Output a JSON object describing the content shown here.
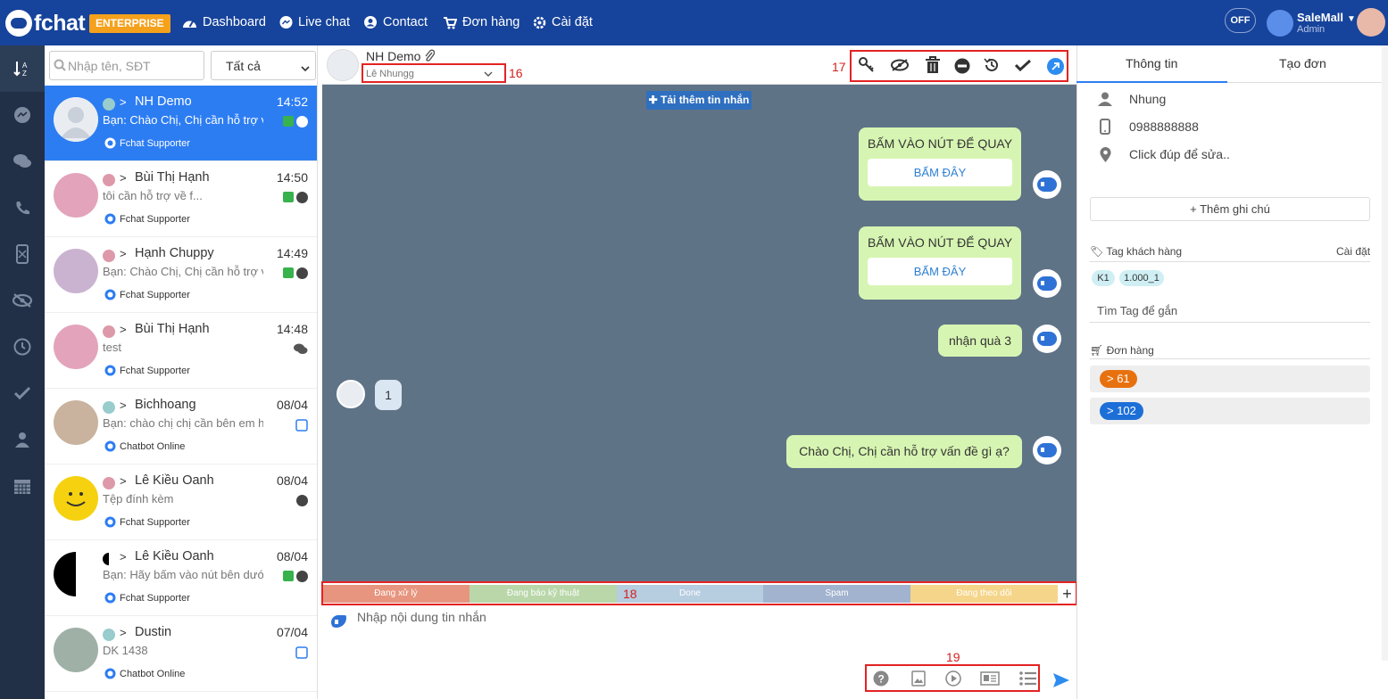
{
  "topbar": {
    "brand": "fchat",
    "plan": "ENTERPRISE",
    "nav": [
      {
        "label": "Dashboard",
        "icon": "dashboard-icon"
      },
      {
        "label": "Live chat",
        "icon": "messenger-icon"
      },
      {
        "label": "Contact",
        "icon": "contact-icon"
      },
      {
        "label": "Đơn hàng",
        "icon": "cart-icon"
      },
      {
        "label": "Cài đặt",
        "icon": "settings-icon"
      }
    ],
    "toggle": "OFF",
    "shop_name": "SaleMall",
    "role": "Admin"
  },
  "search": {
    "placeholder": "Nhập tên, SĐT"
  },
  "filter": {
    "selected": "Tất cả"
  },
  "conversations": [
    {
      "name": "NH Demo",
      "time": "14:52",
      "preview": "Bạn: Chào Chị, Chị cần hỗ trợ v...",
      "agent": "Fchat Supporter"
    },
    {
      "name": "Bùi Thị Hạnh",
      "time": "14:50",
      "preview": "tôi cần hỗ trợ về f...",
      "agent": "Fchat Supporter"
    },
    {
      "name": "Hạnh Chuppy",
      "time": "14:49",
      "preview": "Bạn: Chào Chị, Chị cần hỗ trợ v...",
      "agent": "Fchat Supporter"
    },
    {
      "name": "Bùi Thị Hạnh",
      "time": "14:48",
      "preview": "test",
      "agent": "Fchat Supporter"
    },
    {
      "name": "Bichhoang",
      "time": "08/04",
      "preview": "Bạn: chào chị chị cần bên em h...",
      "agent": "Chatbot Online"
    },
    {
      "name": "Lê Kiều Oanh",
      "time": "08/04",
      "preview": "Tệp đính kèm",
      "agent": "Fchat Supporter"
    },
    {
      "name": "Lê Kiều Oanh",
      "time": "08/04",
      "preview": "Bạn: Hãy bấm vào nút bên dưới...",
      "agent": "Fchat Supporter"
    },
    {
      "name": "Dustin",
      "time": "07/04",
      "preview": "DK 1438",
      "agent": "Chatbot Online"
    }
  ],
  "chat": {
    "contact_name": "NH Demo",
    "assignee": "Lê Nhungg",
    "label_16": "16",
    "label_17": "17",
    "label_18": "18",
    "label_19": "19",
    "load_more": "Tải thêm tin nhắn",
    "messages": [
      {
        "text": "BẤM VÀO NÚT ĐỂ QUAY",
        "button": "BẤM ĐÂY"
      },
      {
        "text": "BẤM VÀO NÚT ĐỂ QUAY",
        "button": "BẤM ĐÂY"
      },
      {
        "text": "nhận quà 3"
      },
      {
        "text": "1"
      },
      {
        "text": "Chào Chị, Chị cần hỗ trợ vấn đề gì ạ?"
      }
    ],
    "tags": [
      {
        "label": "Đang xử lý",
        "color": "#e7957f"
      },
      {
        "label": "Đang báo kỹ thuật",
        "color": "#b9d7a9"
      },
      {
        "label": "Done",
        "color": "#b7cde0"
      },
      {
        "label": "Spam",
        "color": "#a1b3cf"
      },
      {
        "label": "Đang theo dõi",
        "color": "#f5d58a"
      }
    ],
    "input_placeholder": "Nhập nội dung tin nhắn"
  },
  "right": {
    "tab_info": "Thông tin",
    "tab_order": "Tạo đơn",
    "name": "Nhung",
    "phone": "0988888888",
    "address": "Click đúp để sửa..",
    "add_note": "+ Thêm ghi chú",
    "tag_title": "Tag khách hàng",
    "tag_setting": "Cài đặt",
    "tags": [
      "K1",
      "1.000_1"
    ],
    "tag_search": "Tìm Tag để gắn",
    "orders_title": "Đơn hàng",
    "orders": [
      "> 61",
      "> 102"
    ]
  }
}
